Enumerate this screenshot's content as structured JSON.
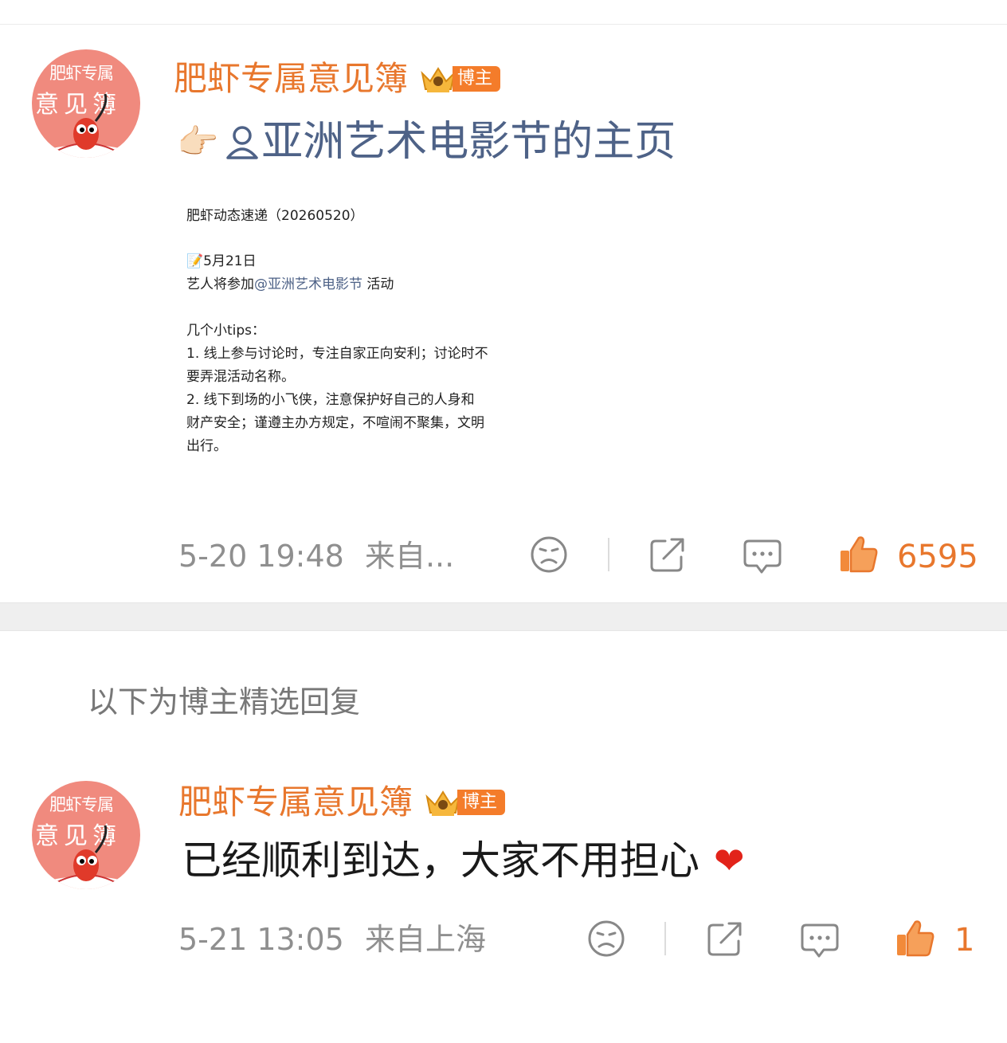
{
  "post": {
    "username": "肥虾专属意见簿",
    "badge": "博主",
    "avatar_text_top": "肥虾专属",
    "avatar_text_bottom": "意见簿",
    "link_pointer": "👉🏻",
    "link_text": "亚洲艺术电影节的主页",
    "image_text": {
      "title": "肥虾动态速递（20260520）",
      "date_icon": "📝",
      "date": "5月21日",
      "line_prefix": "艺人将参加",
      "mention": "@亚洲艺术电影节",
      "line_suffix": " 活动",
      "tips_header": "几个小tips：",
      "tip1_a": "1. 线上参与讨论时，专注自家正向安利；讨论时不",
      "tip1_b": "要弄混活动名称。",
      "tip2_a": "2. 线下到场的小飞侠，注意保护好自己的人身和",
      "tip2_b": "财产安全；谨遵主办方规定，不喧闹不聚集，文明",
      "tip2_c": "出行。"
    },
    "timestamp": "5-20 19:48",
    "source": "来自...",
    "like_count": "6595"
  },
  "section_title": "以下为博主精选回复",
  "reply": {
    "username": "肥虾专属意见簿",
    "badge": "博主",
    "avatar_text_top": "肥虾专属",
    "avatar_text_bottom": "意见簿",
    "text": "已经顺利到达，大家不用担心",
    "emoji": "❤",
    "timestamp": "5-21 13:05",
    "source": "来自上海",
    "like_count": "1"
  },
  "colors": {
    "accent": "#e8772d",
    "link": "#4e6287",
    "meta": "#8f8f8f",
    "divider": "#efefef"
  },
  "icons": [
    "dislike-face-icon",
    "share-icon",
    "comment-icon",
    "thumbs-up-icon",
    "user-icon",
    "pointing-hand-icon",
    "heart-icon",
    "crown-badge-icon"
  ]
}
